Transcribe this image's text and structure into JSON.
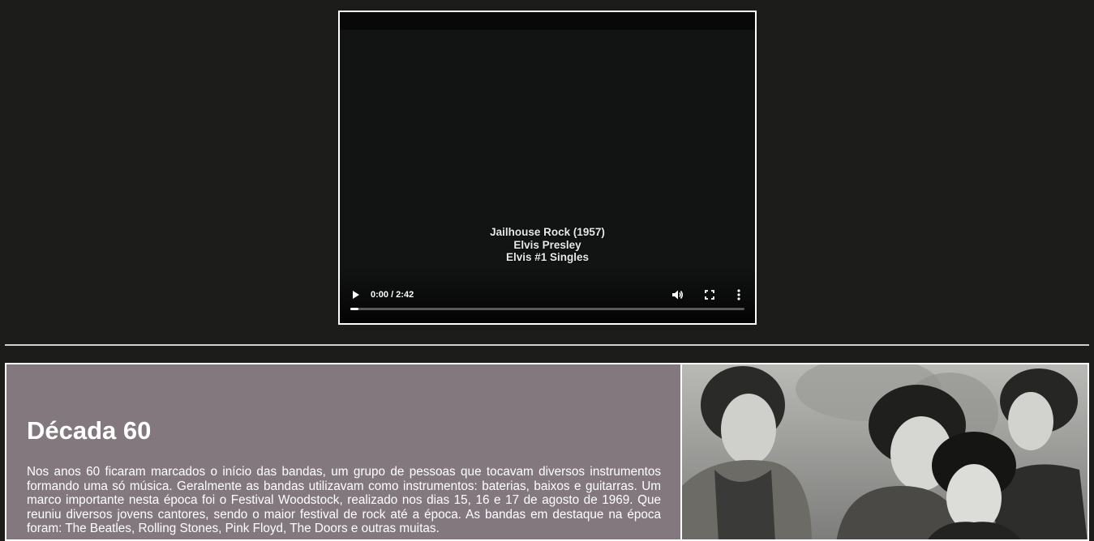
{
  "video": {
    "caption_lines": [
      "Jailhouse Rock (1957)",
      "Elvis Presley",
      "Elvis #1 Singles"
    ],
    "time": "0:00 / 2:42",
    "progress": 0.02,
    "icons": {
      "play": "play-icon",
      "volume": "volume-icon",
      "fullscreen": "fullscreen-icon",
      "more": "more-vertical-icon"
    }
  },
  "section": {
    "title": "Década 60",
    "text": "Nos anos 60 ficaram marcados o início das bandas, um grupo de pessoas que tocavam diversos instrumentos formando uma só música. Geralmente as bandas utilizavam como instrumentos: baterias, baixos e guitarras. Um marco importante nesta época foi o Festival Woodstock, realizado nos dias 15, 16 e 17 de agosto de 1969. Que reuniu diversos jovens cantores, sendo o maior festival de rock até a época. As bandas em destaque na época foram: The Beatles, Rolling Stones, Pink Floyd, The Doors e outras muitas.",
    "panel_color": "#82787e"
  }
}
